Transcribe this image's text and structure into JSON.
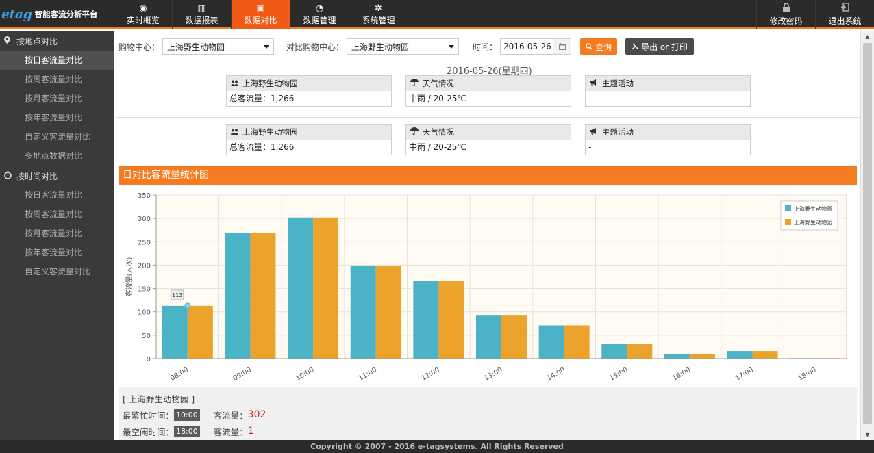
{
  "app": {
    "logo": "etag",
    "name": "智能客流分析平台"
  },
  "nav": [
    {
      "label": "实时概览",
      "icon": "eye-icon",
      "glyph": "◉"
    },
    {
      "label": "数据报表",
      "icon": "bar-chart-icon",
      "glyph": "▥"
    },
    {
      "label": "数据对比",
      "icon": "image-icon",
      "glyph": "▣"
    },
    {
      "label": "数据管理",
      "icon": "pulse-icon",
      "glyph": "◔"
    },
    {
      "label": "系统管理",
      "icon": "gear-icon",
      "glyph": "✲"
    }
  ],
  "nav_right": [
    {
      "label": "修改密码",
      "icon": "lock-icon",
      "glyph": "🔒"
    },
    {
      "label": "退出系统",
      "icon": "logout-icon",
      "glyph": "⇥"
    }
  ],
  "sidebar": {
    "groups": [
      {
        "label": "按地点对比",
        "icon": "map-marker-icon",
        "glyph": "⬤",
        "items": [
          "按日客流量对比",
          "按周客流量对比",
          "按月客流量对比",
          "按年客流量对比",
          "自定义客流量对比",
          "多地点数据对比"
        ]
      },
      {
        "label": "按时间对比",
        "icon": "stopwatch-icon",
        "glyph": "◷",
        "items": [
          "按日客流量对比",
          "按周客流量对比",
          "按月客流量对比",
          "按年客流量对比",
          "自定义客流量对比"
        ]
      }
    ]
  },
  "filters": {
    "mall_label": "购物中心：",
    "mall_value": "上海野生动物园",
    "compare_label": "对比购物中心：",
    "compare_value": "上海野生动物园",
    "time_label": "时间：",
    "date_value": "2016-05-26",
    "query_button": "查询",
    "export_button": "导出 or 打印"
  },
  "date_title": "2016-05-26(星期四)",
  "cards_primary": {
    "mall_name": "上海野生动物园",
    "traffic": "总客流量：1,266",
    "weather_title": "天气情况",
    "weather": "中雨 / 20-25℃",
    "event_title": "主题活动",
    "event": "-"
  },
  "cards_compare": {
    "mall_name": "上海野生动物园",
    "traffic": "总客流量：1,266",
    "weather_title": "天气情况",
    "weather": "中雨 / 20-25℃",
    "event_title": "主题活动",
    "event": "-"
  },
  "panel_title": "日对比客流量统计图",
  "colors": {
    "accent": "#f47b20",
    "series1": "#4ab3c6",
    "series2": "#eba32c"
  },
  "chart_data": {
    "type": "bar",
    "categories": [
      "08:00",
      "09:00",
      "10:00",
      "11:00",
      "12:00",
      "13:00",
      "14:00",
      "15:00",
      "16:00",
      "17:00",
      "18:00"
    ],
    "series": [
      {
        "name": "上海野生动物园",
        "values": [
          113,
          268,
          302,
          198,
          166,
          92,
          71,
          32,
          9,
          16,
          1
        ]
      },
      {
        "name": "上海野生动物园",
        "values": [
          113,
          268,
          302,
          198,
          166,
          92,
          71,
          32,
          9,
          16,
          1
        ]
      }
    ],
    "ylabel": "客流量(人次)",
    "ylim": [
      0,
      350
    ],
    "yticks": [
      0,
      50,
      100,
      150,
      200,
      250,
      300,
      350
    ],
    "tooltip": "113",
    "grid": true,
    "legend": "top-right"
  },
  "stats": {
    "mall_title": "[ 上海野生动物园 ]",
    "busiest_label": "最繁忙时间：",
    "busiest_time": "10:00",
    "busiest_traffic_label": "客流量：",
    "busiest_traffic": "302",
    "idlest_label": "最空闲时间：",
    "idlest_time": "18:00",
    "idlest_traffic_label": "客流量：",
    "idlest_traffic": "1"
  },
  "footer": "Copyright © 2007 - 2016 e-tagsystems. All Rights Reserved"
}
